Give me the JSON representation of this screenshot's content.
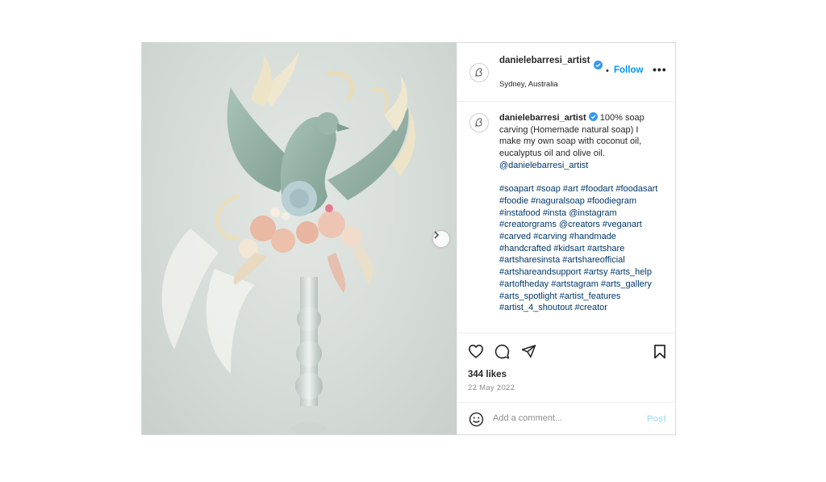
{
  "header": {
    "username": "danielebarresi_artist",
    "location": "Sydney, Australia",
    "follow_label": "Follow",
    "separator": "•",
    "more_label": "•••"
  },
  "caption": {
    "username": "danielebarresi_artist",
    "body": "100% soap carving (Homemade natural soap) I make my own soap with coconut oil, eucalyptus oil and olive oil.",
    "mention": "@danielebarresi_artist",
    "hashtags": "#soapart #soap #art #foodart #foodasart #foodie #naguralsoap #foodiegram #instafood #insta @instagram #creatorgrams @creators #veganart #carved #carving #handmade #handcrafted #kidsart #artshare #artsharesinsta #artshareofficial #artshareandsupport #artsy #arts_help #artoftheday #artstagram #arts_gallery #arts_spotlight #artist_features #artist_4_shoutout #creator"
  },
  "stats": {
    "likes": "344 likes",
    "date": "22 May 2022"
  },
  "comment": {
    "placeholder": "Add a comment...",
    "post_label": "Post"
  },
  "icons": {
    "like": "heart-icon",
    "comment": "comment-icon",
    "share": "share-icon",
    "save": "bookmark-icon",
    "emoji": "emoji-icon",
    "verified": "verified-badge-icon",
    "next": "chevron-right-icon"
  },
  "colors": {
    "accent": "#0095f6",
    "verified": "#3897f0",
    "link": "#00376b",
    "muted": "#8e8e8e",
    "post_disabled": "#b2dffc"
  }
}
